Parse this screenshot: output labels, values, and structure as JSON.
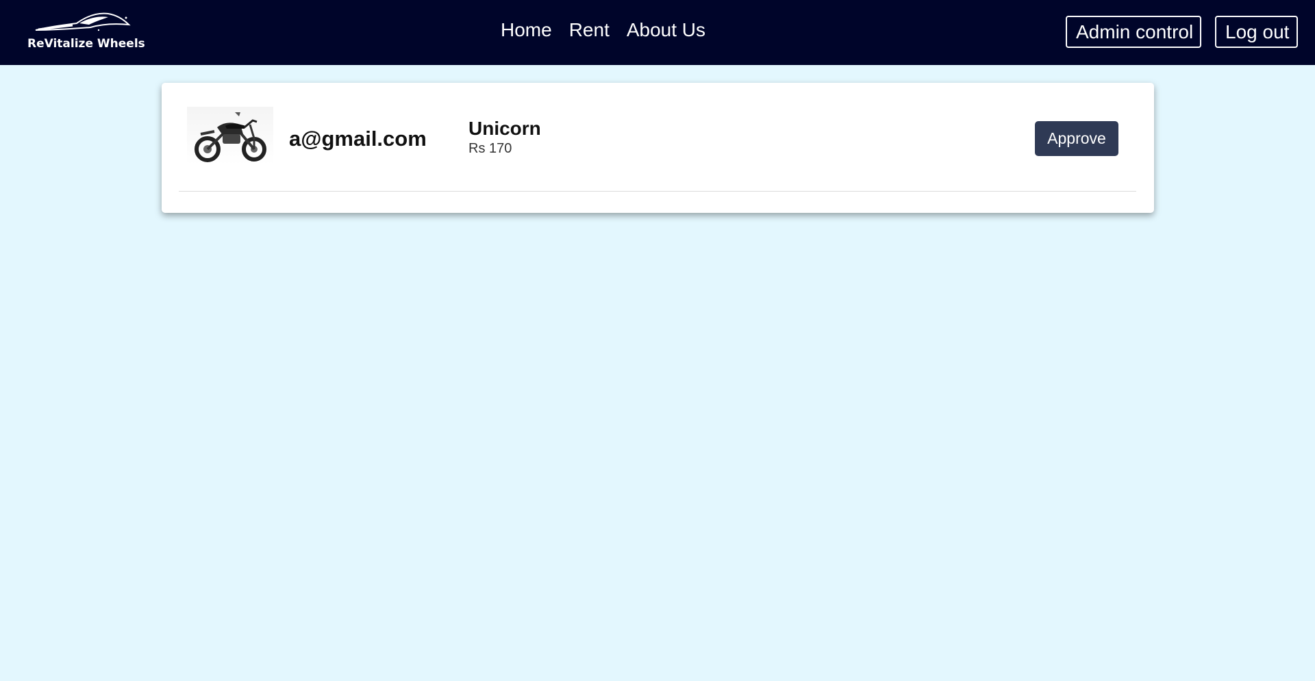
{
  "brand": {
    "name": "ReVitalize Wheels"
  },
  "nav": {
    "links": [
      "Home",
      "Rent",
      "About Us"
    ],
    "admin_label": "Admin control",
    "logout_label": "Log out"
  },
  "requests": [
    {
      "email": "a@gmail.com",
      "vehicle": "Unicorn",
      "price": "Rs 170",
      "image": "motorcycle",
      "action_label": "Approve"
    }
  ],
  "colors": {
    "navbar": "#00052a",
    "page_bg": "#e3f7fe",
    "approve_button": "#2f3a55"
  }
}
